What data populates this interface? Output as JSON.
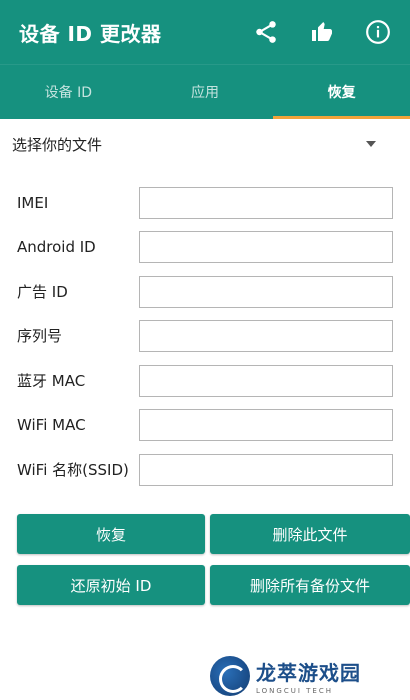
{
  "app": {
    "title": "设备 ID 更改器"
  },
  "toolbar": {
    "share_icon": "share-icon",
    "like_icon": "thumbs-up-icon",
    "info_icon": "info-icon"
  },
  "tabs": [
    {
      "label": "设备 ID",
      "active": false
    },
    {
      "label": "应用",
      "active": false
    },
    {
      "label": "恢复",
      "active": true
    }
  ],
  "file_select": {
    "label": "选择你的文件"
  },
  "fields": [
    {
      "label": "IMEI",
      "value": ""
    },
    {
      "label": "Android ID",
      "value": ""
    },
    {
      "label": "广告 ID",
      "value": ""
    },
    {
      "label": "序列号",
      "value": ""
    },
    {
      "label": "蓝牙 MAC",
      "value": ""
    },
    {
      "label": "WiFi MAC",
      "value": ""
    },
    {
      "label": "WiFi 名称(SSID)",
      "value": ""
    }
  ],
  "buttons": {
    "restore": "恢复",
    "delete_file": "删除此文件",
    "reset_initial_id": "还原初始 ID",
    "delete_all_backups": "删除所有备份文件"
  },
  "watermark": {
    "name": "龙萃游戏园",
    "sub": "LONGCUI TECH"
  },
  "colors": {
    "primary": "#16917f",
    "tab_indicator": "#f2a33a",
    "background": "#ffffff"
  }
}
